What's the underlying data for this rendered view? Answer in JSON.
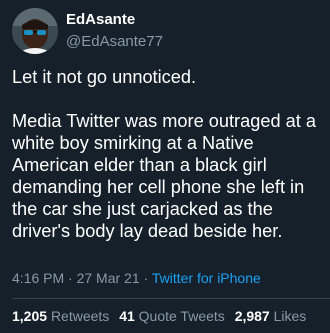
{
  "user": {
    "display_name": "EdAsante",
    "handle": "@EdAsante77",
    "avatar": "avatar-photo"
  },
  "tweet": {
    "text": "Let it not go unnoticed.\n\nMedia Twitter was more outraged at a white boy smirking at a Native American elder than a black girl demanding her cell phone she left in the car she just carjacked as the driver's body lay dead beside her.",
    "time": "4:16 PM",
    "date": "27 Mar 21",
    "separator": "·",
    "source": "Twitter for iPhone"
  },
  "stats": {
    "retweets_count": "1,205",
    "retweets_label": "Retweets",
    "quote_count": "41",
    "quote_label": "Quote Tweets",
    "likes_count": "2,987",
    "likes_label": "Likes"
  },
  "colors": {
    "background": "#15202b",
    "secondary_text": "#8899a6",
    "link": "#1da1f2",
    "divider": "#38444d"
  }
}
